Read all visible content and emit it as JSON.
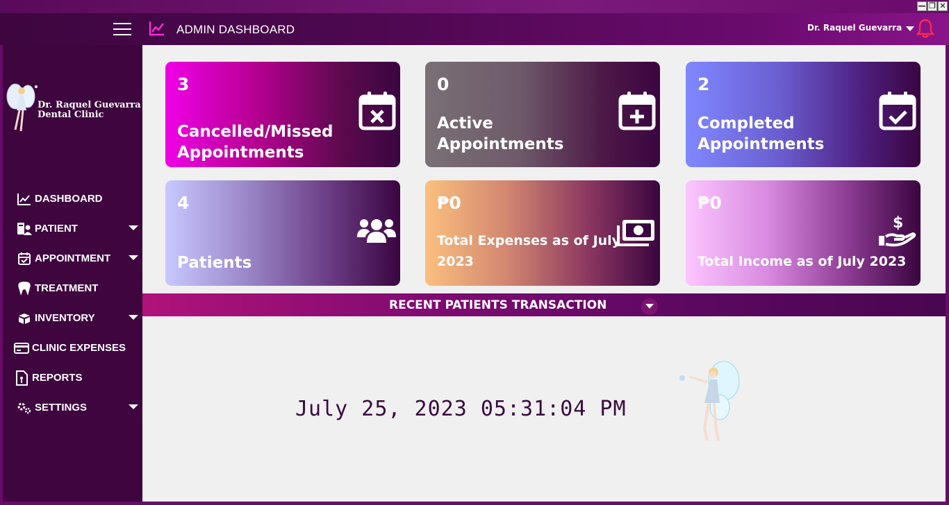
{
  "window": {
    "minimize": "—",
    "restore": "❐",
    "close": "✕"
  },
  "header": {
    "title": "ADMIN DASHBOARD",
    "user": "Dr. Raquel Guevarra"
  },
  "logo": {
    "line1": "Dr. Raquel Guevarra",
    "line2": "Dental Clinic"
  },
  "sidebar": {
    "items": [
      {
        "label": "DASHBOARD",
        "icon": "chart-line-icon"
      },
      {
        "label": "PATIENT",
        "icon": "patient-id-icon",
        "dropdown": true
      },
      {
        "label": "APPOINTMENT",
        "icon": "calendar-check-icon",
        "dropdown": true
      },
      {
        "label": "TREATMENT",
        "icon": "tooth-icon"
      },
      {
        "label": "INVENTORY",
        "icon": "box-icon",
        "dropdown": true
      },
      {
        "label": "CLINIC EXPENSES",
        "icon": "credit-card-icon"
      },
      {
        "label": "REPORTS",
        "icon": "report-file-icon"
      },
      {
        "label": "SETTINGS",
        "icon": "gears-icon",
        "dropdown": true
      }
    ]
  },
  "cards": {
    "cancelled": {
      "value": "3",
      "label": "Cancelled/Missed Appointments"
    },
    "active": {
      "value": "0",
      "label": "Active Appointments"
    },
    "completed": {
      "value": "2",
      "label": "Completed Appointments"
    },
    "patients": {
      "value": "4",
      "label": "Patients"
    },
    "expenses": {
      "value": "₱0",
      "label": "Total Expenses as of July 2023"
    },
    "income": {
      "value": "₱0",
      "label": "Total Income as of July 2023"
    }
  },
  "recent": {
    "title": "RECENT PATIENTS TRANSACTION"
  },
  "clock": {
    "text": "July 25, 2023 05:31:04 PM"
  },
  "colors": {
    "accent": "#6a0b6e",
    "sidebar": "#3e053f",
    "bell": "#ff2a4a"
  }
}
